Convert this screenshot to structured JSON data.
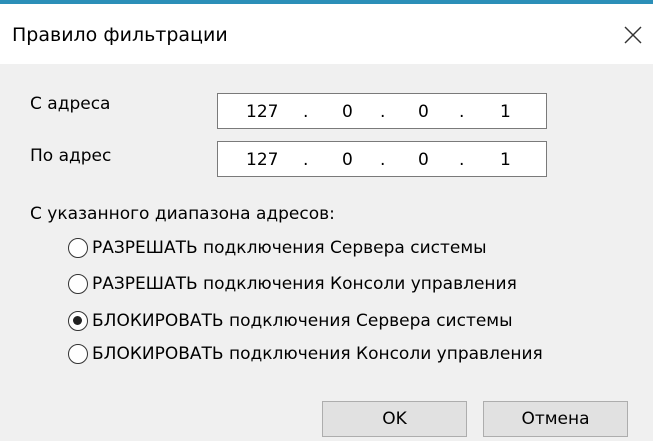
{
  "dialog": {
    "title": "Правило фильтрации",
    "close_icon": "close-icon"
  },
  "from": {
    "label": "С адреса",
    "octets": [
      "127",
      "0",
      "0",
      "1"
    ]
  },
  "to": {
    "label": "По адрес",
    "octets": [
      "127",
      "0",
      "0",
      "1"
    ]
  },
  "range_group": {
    "label": "С указанного диапазона адресов:",
    "options": [
      {
        "label": "РАЗРЕШАТЬ подключения Сервера системы",
        "checked": false
      },
      {
        "label": "РАЗРЕШАТЬ подключения Консоли управления",
        "checked": false
      },
      {
        "label": "БЛОКИРОВАТЬ подключения Сервера системы",
        "checked": true
      },
      {
        "label": "БЛОКИРОВАТЬ подключения Консоли управления",
        "checked": false
      }
    ]
  },
  "buttons": {
    "ok": "OK",
    "cancel": "Отмена"
  },
  "colors": {
    "accent": "#2b8fb8",
    "dialog_bg": "#f0f0f0",
    "titlebar_bg": "#ffffff"
  }
}
